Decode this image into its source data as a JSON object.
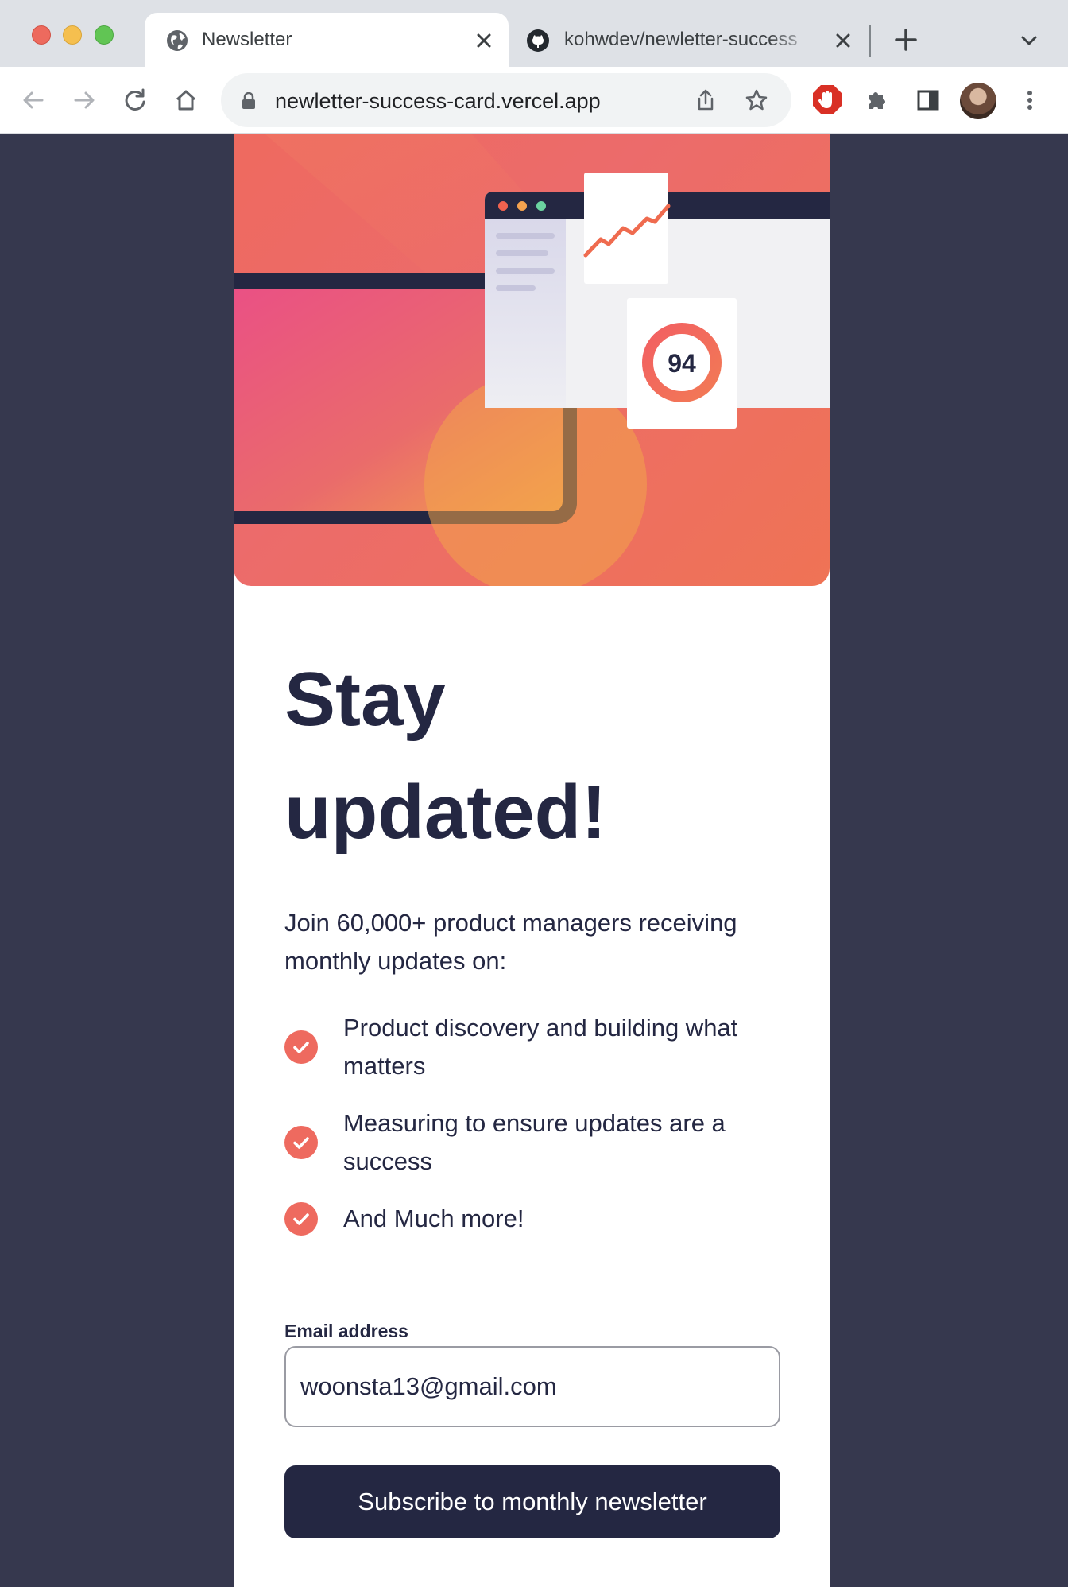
{
  "browser": {
    "tabs": [
      {
        "title": "Newsletter",
        "icon": "globe-icon",
        "active": true
      },
      {
        "title": "kohwdev/newletter-success",
        "icon": "github-icon",
        "active": false
      }
    ],
    "url": "newletter-success-card.vercel.app"
  },
  "hero": {
    "score": "94",
    "colors": {
      "accent": "#ee6a5f",
      "dark": "#242742"
    }
  },
  "main": {
    "heading_line1": "Stay",
    "heading_line2": "updated!",
    "intro": "Join 60,000+ product managers receiving monthly updates on:",
    "benefits": [
      "Product discovery and building what matters",
      "Measuring to ensure updates are a success",
      "And Much more!"
    ]
  },
  "form": {
    "email_label": "Email address",
    "email_value": "woonsta13@gmail.com",
    "submit_label": "Subscribe to monthly newsletter"
  },
  "colors": {
    "page_bg": "#36384e",
    "primary": "#242742",
    "tomato": "#ff6155"
  }
}
